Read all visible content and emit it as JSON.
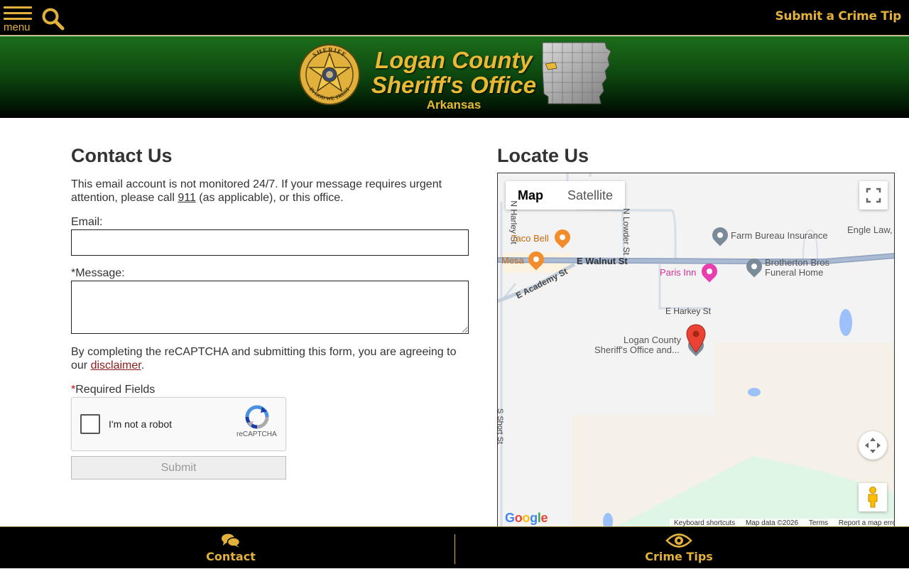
{
  "topbar": {
    "menu_label": "menu",
    "tip_link": "Submit a Crime Tip"
  },
  "header": {
    "title_line1": "Logan County",
    "title_line2": "Sheriff's Office",
    "subtitle": "Arkansas",
    "badge_text_top": "SHERIFF",
    "badge_text_bottom": "IN GOD WE TRUST"
  },
  "contact": {
    "heading": "Contact Us",
    "notice_before": "This email account is not monitored 24/7. If your message requires urgent attention, please call ",
    "notice_link": "911",
    "notice_after": " (as applicable), or this office.",
    "email_label": "Email:",
    "message_label": "*Message:",
    "email_value": "",
    "message_value": "",
    "agree_before": "By completing the reCAPTCHA and submitting this form, you are agreeing to our ",
    "agree_link": "disclaimer",
    "agree_after": ".",
    "required_star": "*",
    "required_text": "Required Fields",
    "captcha_label": "I'm not a robot",
    "captcha_brand": "reCAPTCHA",
    "submit_label": "Submit"
  },
  "locate": {
    "heading": "Locate Us",
    "map_type": [
      "Map",
      "Satellite"
    ],
    "active_map_type": "Map",
    "streets": {
      "harley": "N Harley St",
      "lowder": "N Lowder St",
      "walnut": "E Walnut St",
      "academy": "E Academy St",
      "harkey": "E Harkey St",
      "short": "S Short St"
    },
    "places": {
      "taco_bell": "Taco Bell",
      "mesa": "Mesa",
      "paris_inn": "Paris Inn",
      "farm_bureau": "Farm Bureau Insurance",
      "brotherton_1": "Brotherton Bros",
      "brotherton_2": "Funeral Home",
      "engle": "Engle Law,",
      "sheriff_1": "Logan County",
      "sheriff_2": "Sheriff's Office and..."
    },
    "google_logo": "Google",
    "footer": [
      "Keyboard shortcuts",
      "Map data ©2026",
      "Terms",
      "Report a map error"
    ]
  },
  "bottombar": {
    "contact_label": "Contact",
    "crime_tips_label": "Crime Tips"
  },
  "colors": {
    "gold": "#e2b13c",
    "banner_green": "#1c6d1a",
    "map_pin_red": "#ea4335"
  }
}
